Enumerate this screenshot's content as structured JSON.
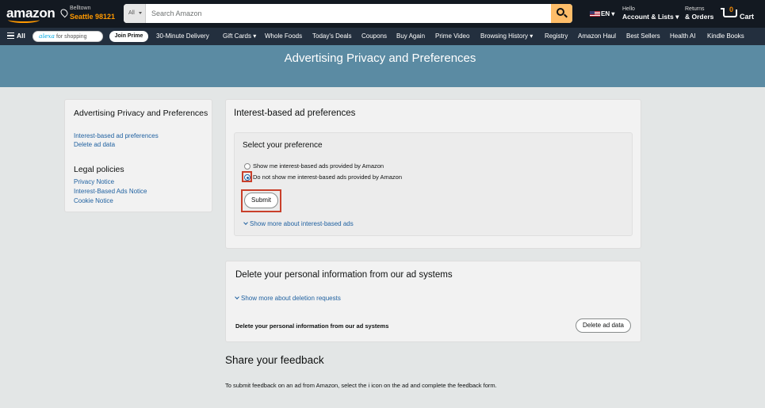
{
  "header": {
    "logo": "amazon",
    "location": {
      "line1": "Belltown",
      "line2": "Seattle 98121"
    },
    "search": {
      "category": "All",
      "placeholder": "Search Amazon",
      "value": ""
    },
    "language": "EN",
    "account": {
      "line1": "Hello",
      "line2": "Account & Lists"
    },
    "orders": {
      "line1": "Returns",
      "line2": "& Orders"
    },
    "cart": {
      "count": "0",
      "label": "Cart"
    }
  },
  "nav": {
    "all_label": "All",
    "alexa": {
      "brand": "alexa",
      "text": "for shopping"
    },
    "join_prime": "Join Prime",
    "links": [
      "30-Minute Delivery",
      "Gift Cards",
      "Whole Foods",
      "Today's Deals",
      "Coupons",
      "Buy Again",
      "Prime Video",
      "Browsing History",
      "Registry",
      "Amazon Haul",
      "Best Sellers",
      "Health AI",
      "Kindle Books"
    ]
  },
  "banner": {
    "title": "Advertising Privacy and Preferences"
  },
  "sidebar": {
    "heading1": "Advertising Privacy and Preferences",
    "links1": [
      "Interest-based ad preferences",
      "Delete ad data"
    ],
    "heading2": "Legal policies",
    "links2": [
      "Privacy Notice",
      "Interest-Based Ads Notice",
      "Cookie Notice"
    ]
  },
  "preferences": {
    "title": "Interest-based ad preferences",
    "subtitle": "Select your preference",
    "options": [
      {
        "label": "Show me interest-based ads provided by Amazon",
        "checked": false
      },
      {
        "label": "Do not show me interest-based ads provided by Amazon",
        "checked": true
      }
    ],
    "submit": "Submit",
    "show_more": "Show more about interest-based ads"
  },
  "delete_section": {
    "title": "Delete your personal information from our ad systems",
    "show_more": "Show more about deletion requests",
    "row_label": "Delete your personal information from our ad systems",
    "button": "Delete ad data"
  },
  "feedback": {
    "title": "Share your feedback",
    "text": "To submit feedback on an ad from Amazon, select the i icon on the ad and complete the feedback form."
  },
  "colors": {
    "header_bg": "#131921",
    "nav_bg": "#232f3e",
    "banner_bg": "#5b8ba3",
    "accent": "#ff9900",
    "search_button": "#febd69",
    "link": "#2162a1",
    "highlight": "#c9402b"
  }
}
